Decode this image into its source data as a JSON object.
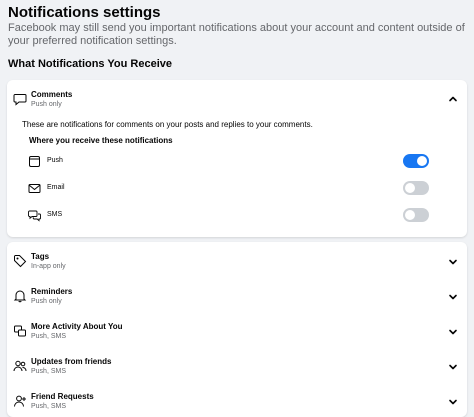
{
  "page": {
    "title": "Notifications settings",
    "subtitle": "Facebook may still send you important notifications about your account and content outside of your preferred notification settings.",
    "section_heading": "What Notifications You Receive"
  },
  "expanded": {
    "title": "Comments",
    "subtitle": "Push only",
    "description": "These are notifications for comments on your posts and replies to your comments.",
    "where_label": "Where you receive these notifications",
    "options": [
      {
        "label": "Push",
        "icon": "push-icon",
        "on": true
      },
      {
        "label": "Email",
        "icon": "email-icon",
        "on": false
      },
      {
        "label": "SMS",
        "icon": "sms-icon",
        "on": false
      }
    ]
  },
  "categories": [
    {
      "title": "Tags",
      "subtitle": "In-app only",
      "icon": "tag-icon"
    },
    {
      "title": "Reminders",
      "subtitle": "Push only",
      "icon": "bell-icon"
    },
    {
      "title": "More Activity About You",
      "subtitle": "Push, SMS",
      "icon": "activity-icon"
    },
    {
      "title": "Updates from friends",
      "subtitle": "Push, SMS",
      "icon": "friends-icon"
    },
    {
      "title": "Friend Requests",
      "subtitle": "Push, SMS",
      "icon": "friend-request-icon"
    }
  ],
  "colors": {
    "accent": "#1877f2",
    "toggle_off": "#ccd0d5",
    "background": "#f0f2f5",
    "secondary_text": "#65676b"
  }
}
